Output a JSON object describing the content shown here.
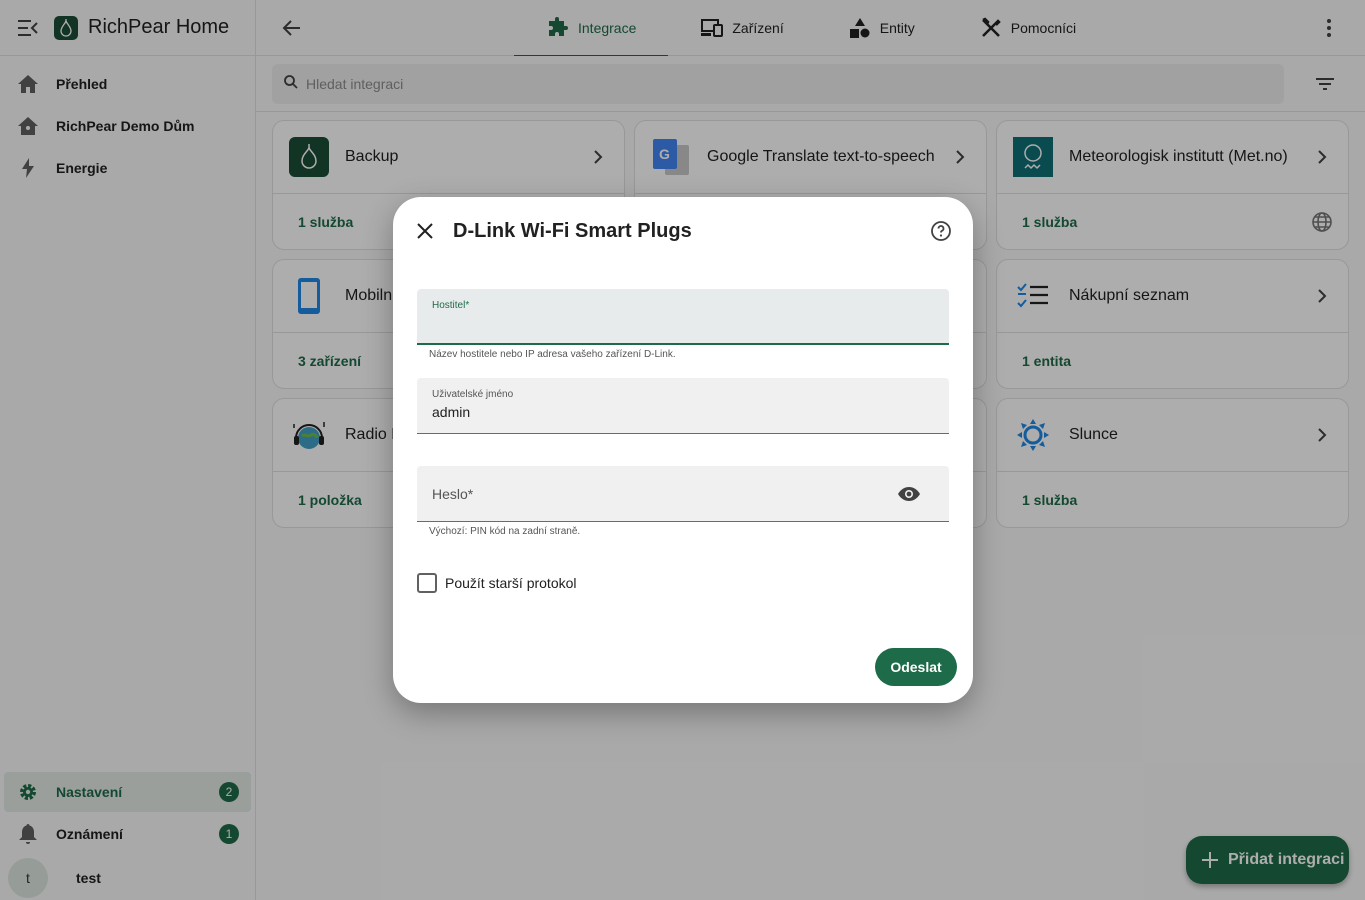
{
  "app": {
    "title": "RichPear Home"
  },
  "sidebar": {
    "items": [
      {
        "label": "Přehled",
        "icon": "home-icon"
      },
      {
        "label": "RichPear Demo Dům",
        "icon": "house-icon"
      },
      {
        "label": "Energie",
        "icon": "lightning-icon"
      }
    ],
    "bottom": [
      {
        "label": "Nastavení",
        "icon": "gear-icon",
        "badge": "2"
      },
      {
        "label": "Oznámení",
        "icon": "bell-icon",
        "badge": "1"
      }
    ],
    "user": {
      "initial": "t",
      "name": "test"
    }
  },
  "tabs": [
    {
      "label": "Integrace",
      "icon": "puzzle-icon",
      "active": true
    },
    {
      "label": "Zařízení",
      "icon": "devices-icon",
      "active": false
    },
    {
      "label": "Entity",
      "icon": "shapes-icon",
      "active": false
    },
    {
      "label": "Pomocníci",
      "icon": "tools-icon",
      "active": false
    }
  ],
  "search": {
    "placeholder": "Hledat integraci"
  },
  "cards": [
    {
      "name": "Backup",
      "status": "1 služba"
    },
    {
      "name": "Google Translate text-to-speech",
      "status": ""
    },
    {
      "name": "Meteorologisk institutt (Met.no)",
      "status": "1 služba"
    },
    {
      "name": "Mobiln",
      "status": "3 zařízení"
    },
    {
      "name": "",
      "status": ""
    },
    {
      "name": "Nákupní seznam",
      "status": "1 entita"
    },
    {
      "name": "Radio B",
      "status": "1 položka"
    },
    {
      "name": "",
      "status": ""
    },
    {
      "name": "Slunce",
      "status": "1 služba"
    }
  ],
  "fab": {
    "label": "Přidat integraci"
  },
  "dialog": {
    "title": "D-Link Wi-Fi Smart Plugs",
    "host": {
      "label": "Hostitel*",
      "value": "",
      "helper": "Název hostitele nebo IP adresa vašeho zařízení D-Link."
    },
    "username": {
      "label": "Uživatelské jméno",
      "value": "admin"
    },
    "password": {
      "label": "Heslo*",
      "helper": "Výchozí: PIN kód na zadní straně."
    },
    "legacy": {
      "label": "Použít starší protokol"
    },
    "submit": "Odeslat"
  },
  "colors": {
    "primary": "#1e6b49",
    "scrim": "rgba(0,0,0,0.32)"
  }
}
